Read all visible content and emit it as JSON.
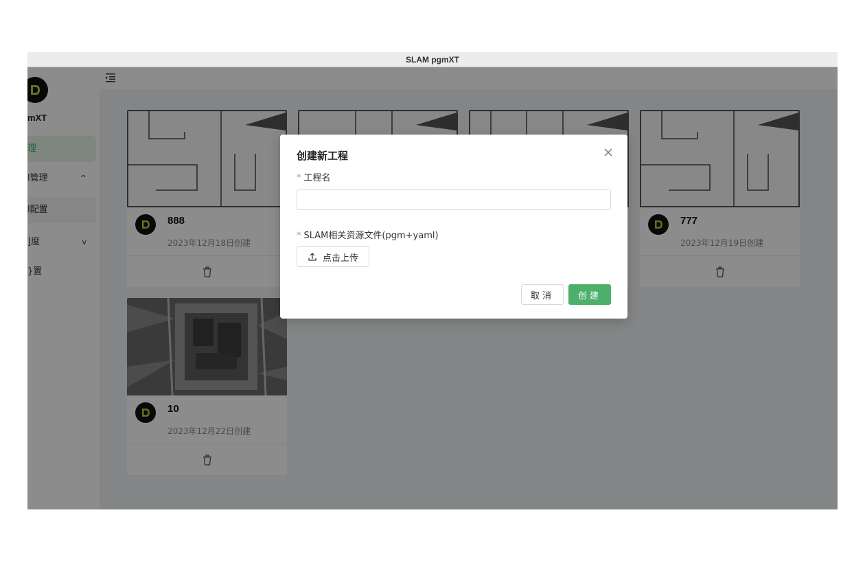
{
  "window": {
    "title": "SLAM pgmXT"
  },
  "sidebar": {
    "brand": "mXT",
    "items": [
      {
        "label": "理",
        "active": true
      },
      {
        "label": "l管理",
        "chevron": "^"
      },
      {
        "label": "l配置"
      },
      {
        "label": "]度",
        "chevron": "v"
      },
      {
        "label": "}置"
      }
    ]
  },
  "projects": [
    {
      "name": "888",
      "created": "2023年12月18日创建"
    },
    {
      "name": "777",
      "created": "2023年12月19日创建"
    },
    {
      "name": "10",
      "created": "2023年12月22日创建"
    }
  ],
  "dialog": {
    "title": "创建新工程",
    "name_field": {
      "required_mark": "*",
      "label": "工程名",
      "value": "",
      "placeholder": ""
    },
    "file_field": {
      "required_mark": "*",
      "label": "SLAM相关资源文件(pgm+yaml)"
    },
    "upload_label": "点击上传",
    "cancel_label": "取消",
    "create_label": "创建"
  },
  "colors": {
    "accent": "#4caf6a",
    "overlay": "rgba(0,0,0,0.45)"
  },
  "icons": {
    "close": "close-icon",
    "upload": "upload-icon",
    "delete": "trash-icon",
    "menu": "menu-fold-icon",
    "logo": "pgmxt-logo-icon"
  }
}
